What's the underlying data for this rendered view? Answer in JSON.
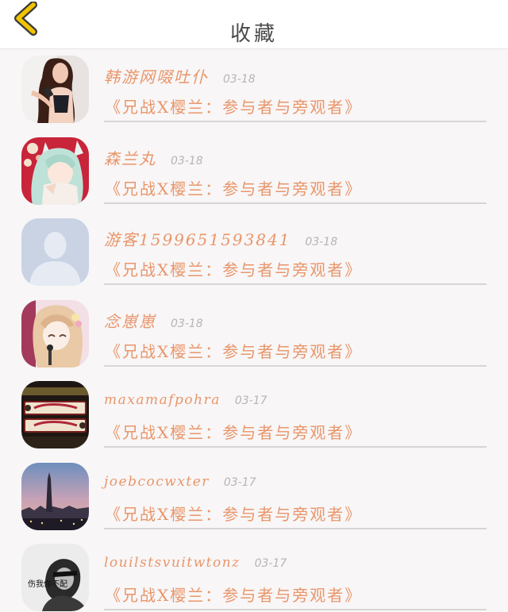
{
  "header": {
    "title": "收藏",
    "back_icon": "chevron-left-icon",
    "back_color": "#f2c400"
  },
  "favorites": [
    {
      "user": "韩游网啜吐仆",
      "date": "03-18",
      "topic": "《兄战X樱兰：参与者与旁观者》",
      "avatar": "girl-portrait"
    },
    {
      "user": "森兰丸",
      "date": "03-18",
      "topic": "《兄战X樱兰：参与者与旁观者》",
      "avatar": "anime-fox-girl"
    },
    {
      "user": "游客1599651593841",
      "date": "03-18",
      "topic": "《兄战X樱兰：参与者与旁观者》",
      "avatar": "default-silhouette"
    },
    {
      "user": "念崽崽",
      "date": "03-18",
      "topic": "《兄战X樱兰：参与者与旁观者》",
      "avatar": "anime-girl-flowers"
    },
    {
      "user": "maxamafpohra",
      "date": "03-17",
      "topic": "《兄战X樱兰：参与者与旁观者》",
      "avatar": "disney-sign"
    },
    {
      "user": "joebcocwxter",
      "date": "03-17",
      "topic": "《兄战X樱兰：参与者与旁观者》",
      "avatar": "city-skyline"
    },
    {
      "user": "louilstsvuitwtonz",
      "date": "03-17",
      "topic": "《兄战X樱兰：参与者与旁观者》",
      "avatar": "bw-photo-caption"
    }
  ],
  "avatar_caption_7": "伤我你不配",
  "colors": {
    "accent": "#e9966a",
    "date": "#b9b4b4",
    "divider": "#d7d5d6",
    "title": "#4a4a4a"
  }
}
